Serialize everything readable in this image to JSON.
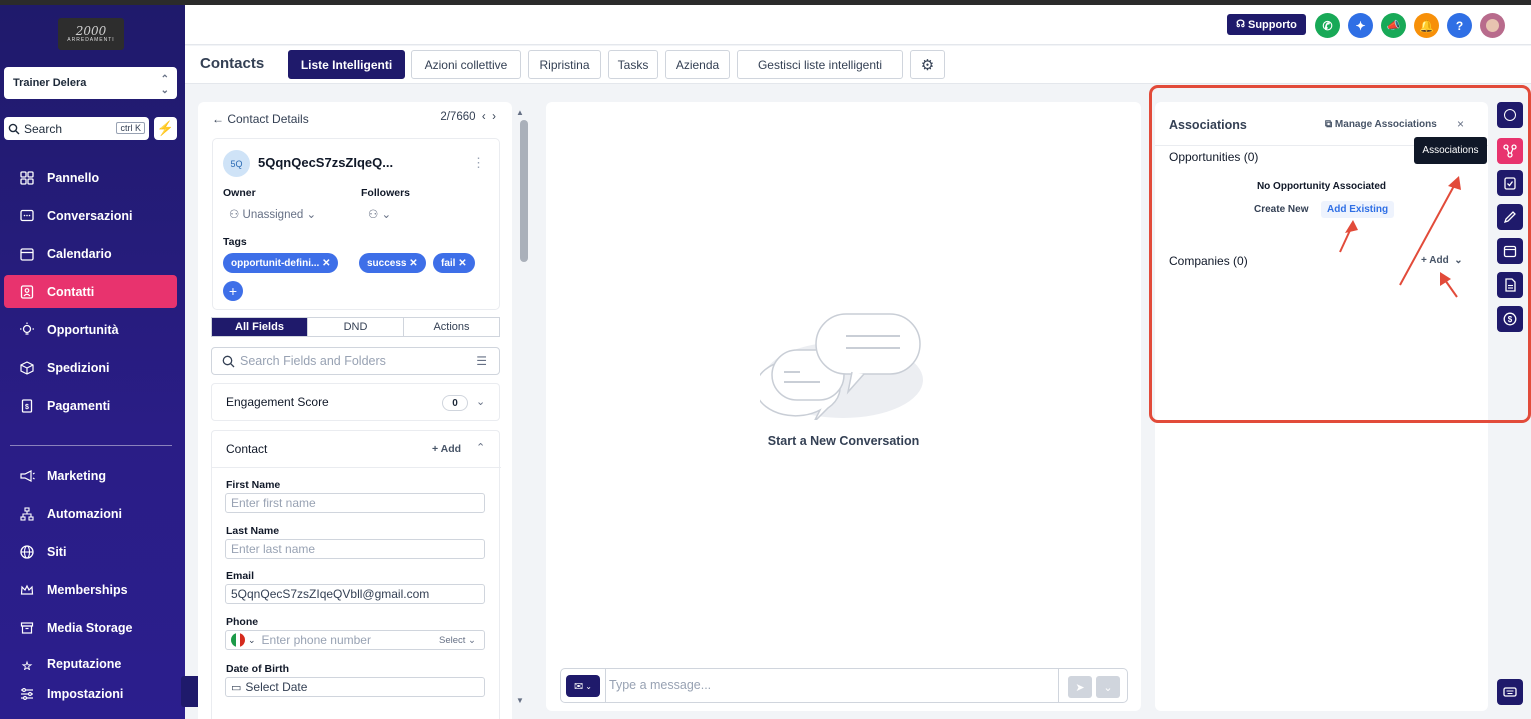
{
  "logo": {
    "line1": "2000",
    "line2": "ARREDAMENTI"
  },
  "account": {
    "name": "Trainer Delera"
  },
  "search": {
    "label": "Search",
    "shortcut": "ctrl K"
  },
  "sidebar": {
    "items": [
      {
        "label": "Pannello",
        "icon": "dashboard-icon"
      },
      {
        "label": "Conversazioni",
        "icon": "chat-icon"
      },
      {
        "label": "Calendario",
        "icon": "calendar-icon"
      },
      {
        "label": "Contatti",
        "icon": "contact-icon"
      },
      {
        "label": "Opportunità",
        "icon": "lightbulb-icon"
      },
      {
        "label": "Spedizioni",
        "icon": "box-icon"
      },
      {
        "label": "Pagamenti",
        "icon": "invoice-icon"
      },
      {
        "label": "Marketing",
        "icon": "megaphone-icon"
      },
      {
        "label": "Automazioni",
        "icon": "workflow-icon"
      },
      {
        "label": "Siti",
        "icon": "globe-icon"
      },
      {
        "label": "Memberships",
        "icon": "crown-icon"
      },
      {
        "label": "Media Storage",
        "icon": "storage-icon"
      },
      {
        "label": "Reputazione",
        "icon": "star-icon"
      },
      {
        "label": "Impostazioni",
        "icon": "settings-icon"
      }
    ]
  },
  "topbar": {
    "support_label": "Supporto"
  },
  "tabs": {
    "page_title": "Contacts",
    "items": [
      "Liste Intelligenti",
      "Azioni collettive",
      "Ripristina",
      "Tasks",
      "Azienda",
      "Gestisci liste intelligenti"
    ]
  },
  "contact": {
    "header": "Contact Details",
    "counter": "2/7660",
    "avatar_initials": "5Q",
    "name": "5QqnQecS7zsZIqeQ...",
    "owner_label": "Owner",
    "owner_value": "Unassigned",
    "followers_label": "Followers",
    "tags_label": "Tags",
    "tags": [
      "opportunit-defini...",
      "success",
      "fail"
    ],
    "segments": [
      "All Fields",
      "DND",
      "Actions"
    ],
    "search_placeholder": "Search Fields and Folders",
    "engagement_label": "Engagement Score",
    "engagement_value": "0",
    "contact_section": "Contact",
    "add_label": "Add",
    "fields": {
      "first_name_label": "First Name",
      "first_name_placeholder": "Enter first name",
      "last_name_label": "Last Name",
      "last_name_placeholder": "Enter last name",
      "email_label": "Email",
      "email_value": "5QqnQecS7zsZIqeQVbll@gmail.com",
      "phone_label": "Phone",
      "phone_placeholder": "Enter phone number",
      "phone_select": "Select",
      "dob_label": "Date of Birth",
      "dob_placeholder": "Select Date"
    }
  },
  "conversation": {
    "empty_title": "Start a New Conversation",
    "message_placeholder": "Type a message..."
  },
  "associations": {
    "title": "Associations",
    "manage_label": "Manage Associations",
    "close": "×",
    "opportunities_label": "Opportunities (0)",
    "no_opportunity": "No Opportunity Associated",
    "create_new": "Create New",
    "add_existing": "Add Existing",
    "companies_label": "Companies (0)",
    "add_label": "Add",
    "tooltip": "Associations"
  },
  "colors": {
    "sidebar": "#1f1a6b",
    "accent_pink": "#e8336e",
    "tag_blue": "#3e6fe8",
    "highlight_red": "#e24b3a"
  }
}
